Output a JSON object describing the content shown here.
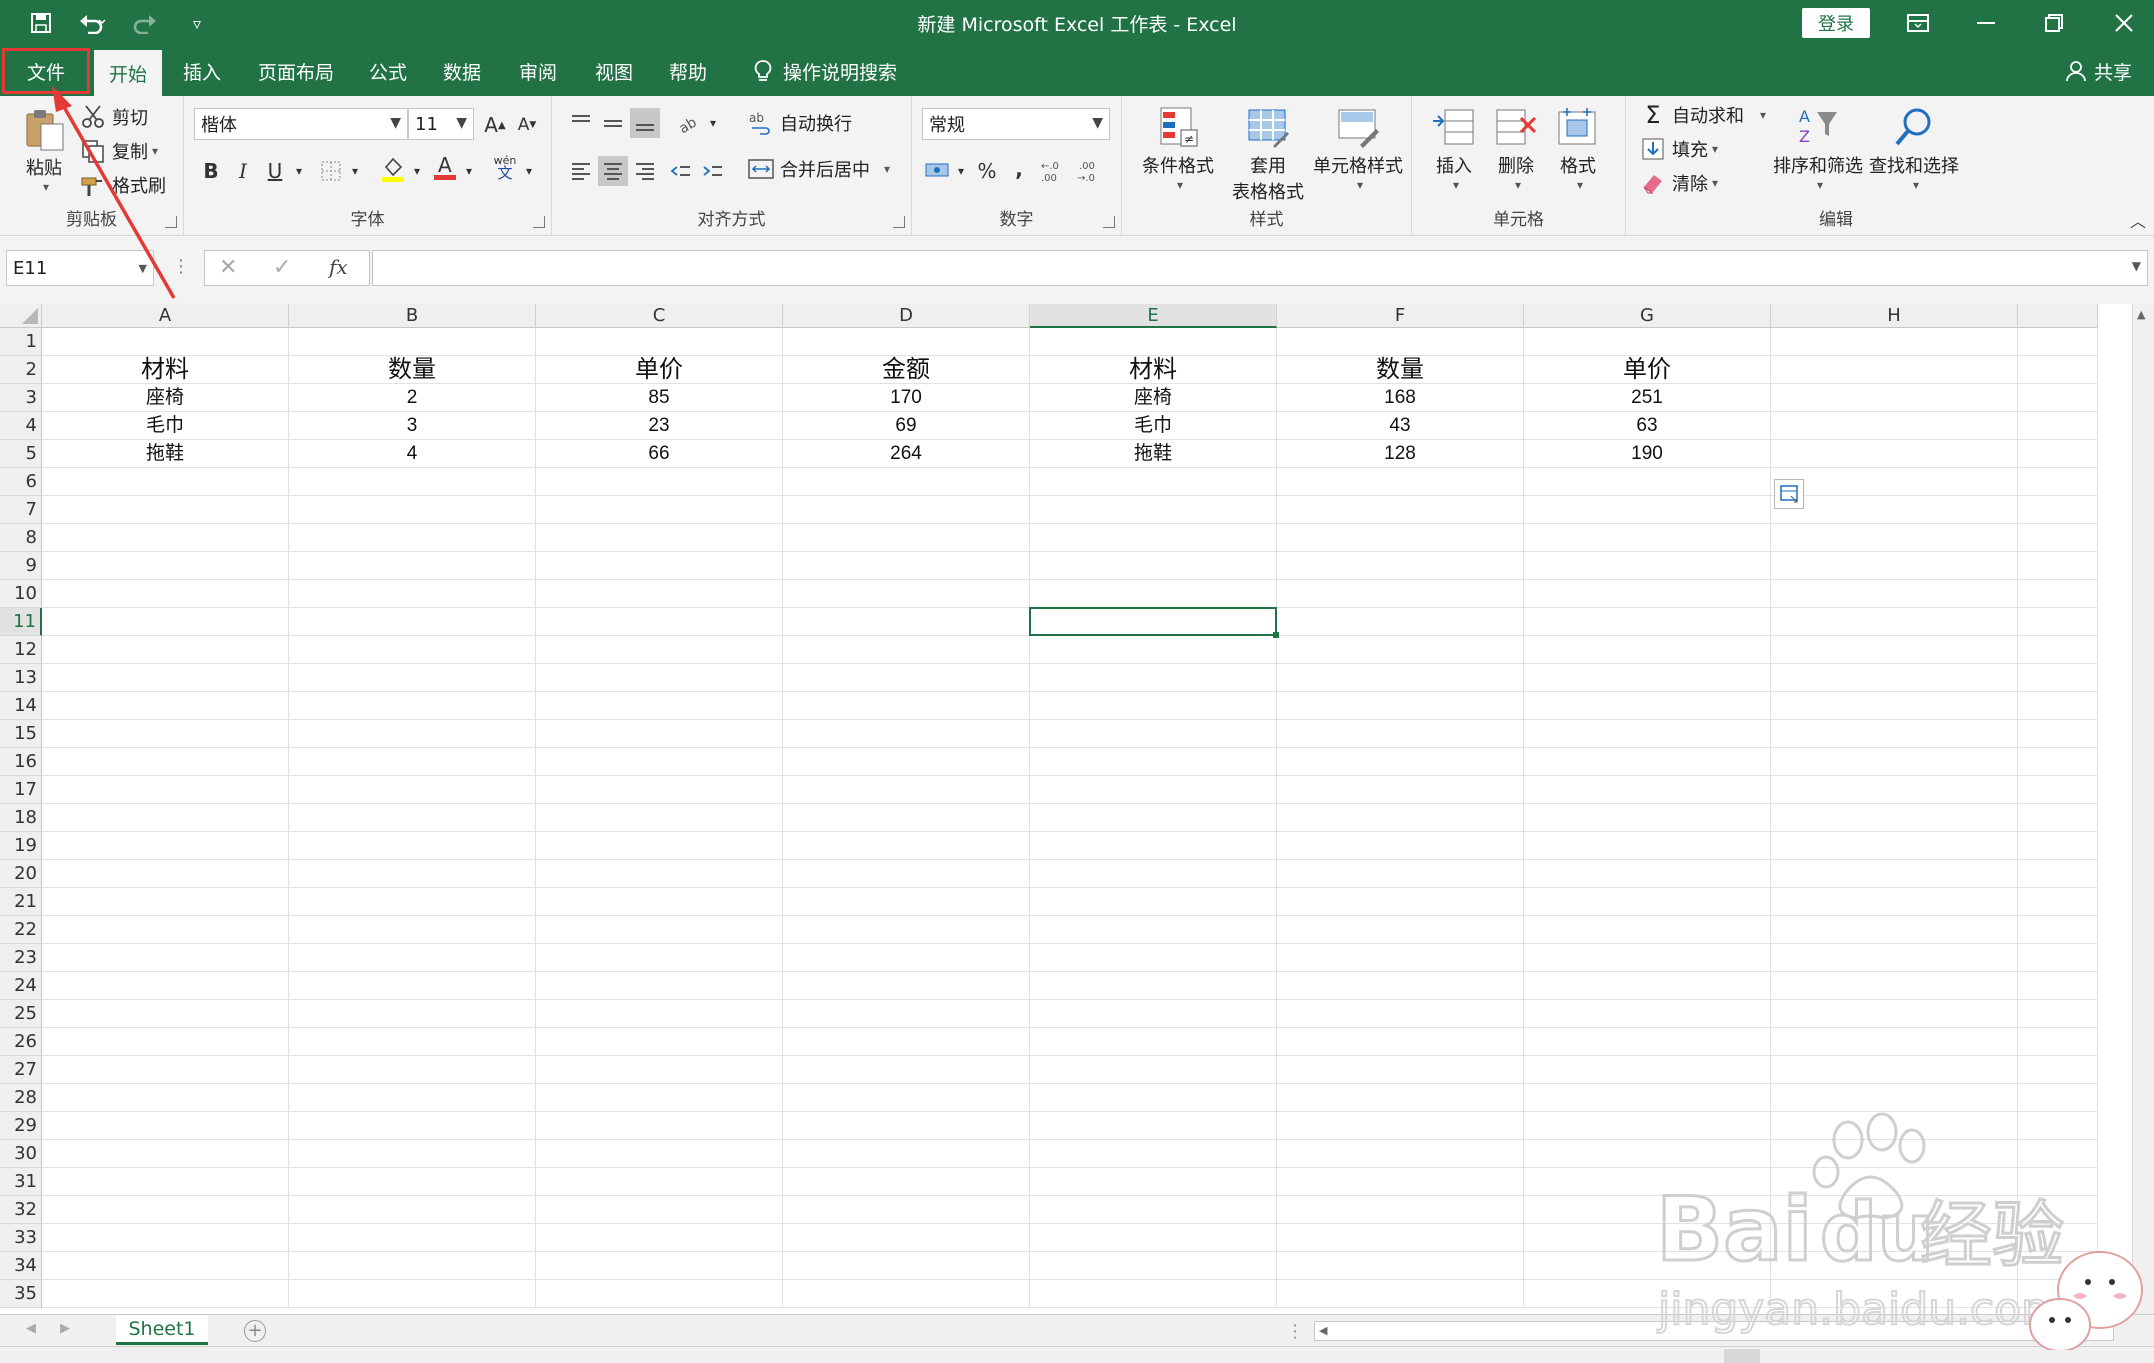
{
  "title_bar": {
    "title": "新建 Microsoft Excel 工作表 - Excel",
    "login_label": "登录",
    "qat_icons": [
      "save-icon",
      "undo-icon",
      "redo-icon",
      "customize-icon"
    ],
    "window_icons": [
      "ribbon-display-icon",
      "minimize-icon",
      "restore-icon",
      "close-icon"
    ]
  },
  "tabs": [
    {
      "label": "文件"
    },
    {
      "label": "开始"
    },
    {
      "label": "插入"
    },
    {
      "label": "页面布局"
    },
    {
      "label": "公式"
    },
    {
      "label": "数据"
    },
    {
      "label": "审阅"
    },
    {
      "label": "视图"
    },
    {
      "label": "帮助"
    },
    {
      "label": "操作说明搜索"
    }
  ],
  "share_label": "共享",
  "ribbon": {
    "clipboard": {
      "label": "剪贴板",
      "paste": "粘贴",
      "cut": "剪切",
      "copy": "复制",
      "format_painter": "格式刷"
    },
    "font": {
      "label": "字体",
      "font_name": "楷体",
      "font_size": "11",
      "bold": "B",
      "italic": "I",
      "underline": "U",
      "pinyin": "wén",
      "pinyin_char": "文"
    },
    "alignment": {
      "label": "对齐方式",
      "wrap_text": "自动换行",
      "merge_center": "合并后居中"
    },
    "number": {
      "label": "数字",
      "format": "常规",
      "percent": "%",
      "comma": ","
    },
    "styles": {
      "label": "样式",
      "conditional": "条件格式",
      "table_format_1": "套用",
      "table_format_2": "表格格式",
      "cell_styles": "单元格样式"
    },
    "cells": {
      "label": "单元格",
      "insert": "插入",
      "delete": "删除",
      "format": "格式"
    },
    "editing": {
      "label": "编辑",
      "autosum": "自动求和",
      "fill": "填充",
      "clear": "清除",
      "sort_filter": "排序和筛选",
      "find_select": "查找和选择"
    }
  },
  "formula_bar": {
    "name_box": "E11",
    "fx": "fx",
    "value": ""
  },
  "grid": {
    "columns": [
      "A",
      "B",
      "C",
      "D",
      "E",
      "F",
      "G",
      "H"
    ],
    "row_count": 35,
    "selected_cell": "E11",
    "selected_col": "E",
    "selected_row": 11,
    "header_row": [
      "材料",
      "数量",
      "单价",
      "金额",
      "材料",
      "数量",
      "单价"
    ],
    "data_rows": [
      [
        "座椅",
        "2",
        "85",
        "170",
        "座椅",
        "168",
        "251"
      ],
      [
        "毛巾",
        "3",
        "23",
        "69",
        "毛巾",
        "43",
        "63"
      ],
      [
        "拖鞋",
        "4",
        "66",
        "264",
        "拖鞋",
        "128",
        "190"
      ]
    ]
  },
  "sheets": [
    {
      "name": "Sheet1"
    }
  ],
  "watermark": {
    "brand_1": "Bai",
    "brand_2": "du",
    "brand_3": "经验",
    "url": "jingyan.baidu.com"
  },
  "colors": {
    "accent": "#217346",
    "annotation": "#e53935"
  }
}
